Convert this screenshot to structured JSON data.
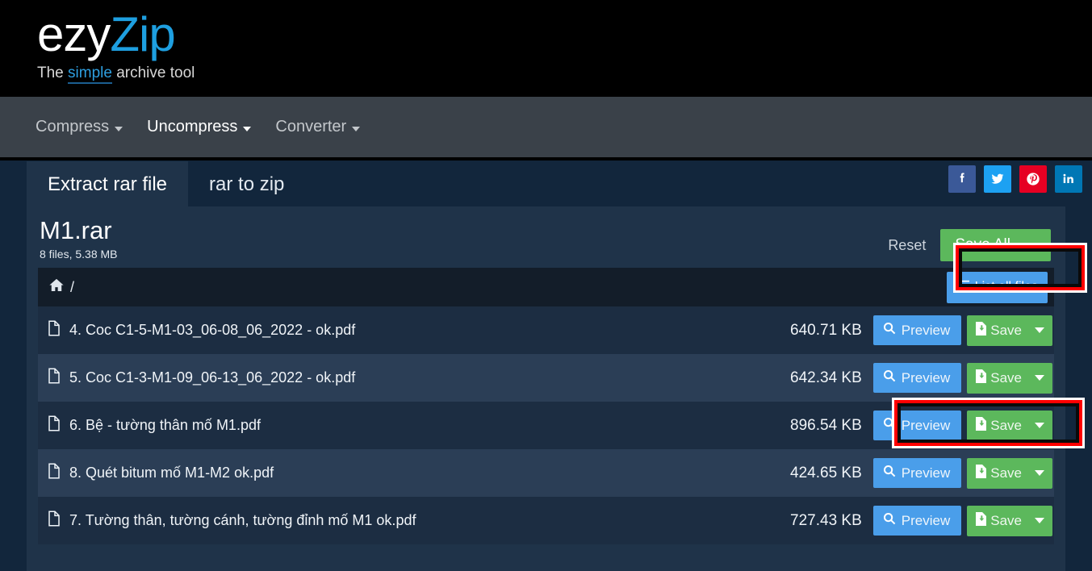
{
  "header": {
    "logo_primary": "ezy",
    "logo_accent": "Zip",
    "tagline_pre": "The ",
    "tagline_accent": "simple",
    "tagline_post": " archive tool",
    "accent_color": "#1e9fe0"
  },
  "navbar": {
    "items": [
      {
        "label": "Compress",
        "active": false
      },
      {
        "label": "Uncompress",
        "active": true
      },
      {
        "label": "Converter",
        "active": false
      }
    ]
  },
  "tabs": [
    {
      "label": "Extract rar file",
      "active": true
    },
    {
      "label": "rar to zip",
      "active": false
    }
  ],
  "social": [
    {
      "name": "facebook",
      "color": "#3b5998",
      "glyph": "f"
    },
    {
      "name": "twitter",
      "color": "#1da1f2",
      "glyph": "t"
    },
    {
      "name": "pinterest",
      "color": "#e60023",
      "glyph": "p"
    },
    {
      "name": "linkedin",
      "color": "#0077b5",
      "glyph": "in"
    }
  ],
  "archive": {
    "title": "M1.rar",
    "subtitle": "8 files, 5.38 MB",
    "reset_label": "Reset",
    "save_all_label": "Save All"
  },
  "breadcrumb": {
    "home_icon": "home-icon",
    "path": "/",
    "list_all_label": "List all files"
  },
  "row_actions": {
    "preview_label": "Preview",
    "save_label": "Save"
  },
  "files": [
    {
      "name": "4. Coc C1-5-M1-03_06-08_06_2022 - ok.pdf",
      "size": "640.71 KB"
    },
    {
      "name": "5. Coc C1-3-M1-09_06-13_06_2022 - ok.pdf",
      "size": "642.34 KB"
    },
    {
      "name": "6. Bệ - tường thân mố M1.pdf",
      "size": "896.54 KB"
    },
    {
      "name": "8. Quét bitum mố M1-M2 ok.pdf",
      "size": "424.65 KB"
    },
    {
      "name": "7. Tường thân, tường cánh, tường đỉnh mố M1 ok.pdf",
      "size": "727.43 KB"
    }
  ],
  "annotations": {
    "color": "#ff0000",
    "targets": [
      "save-all-button",
      "row-2-preview-and-save-buttons"
    ]
  },
  "colors": {
    "page_background": "#12263c",
    "card_background": "#1f3349",
    "row_background": "#1c2d42",
    "row_alt_background": "#2b3e56",
    "primary_button": "#4a9eea",
    "success_button": "#5cb85c",
    "navbar_background": "#3a4149"
  }
}
